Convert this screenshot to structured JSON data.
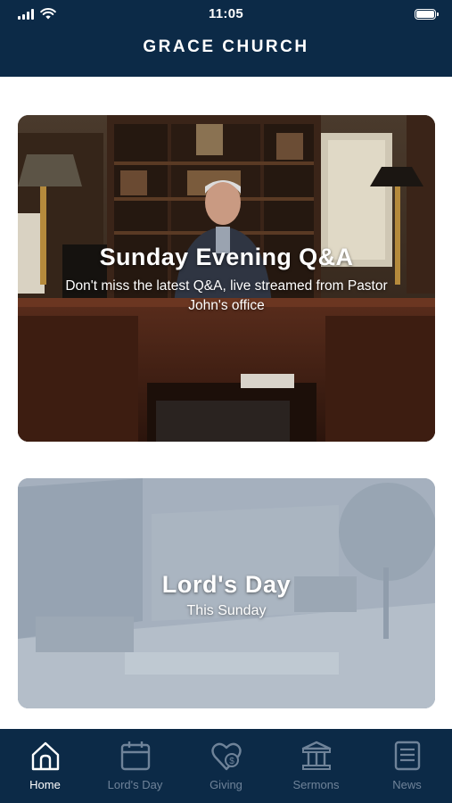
{
  "status_bar": {
    "time": "11:05"
  },
  "header": {
    "title": "GRACE CHURCH"
  },
  "cards": [
    {
      "title": "Sunday Evening Q&A",
      "subtitle": "Don't miss the latest Q&A, live streamed from Pastor John's office"
    },
    {
      "title": "Lord's Day",
      "subtitle": "This Sunday"
    }
  ],
  "tabs": [
    {
      "label": "Home",
      "icon": "home-icon",
      "active": true
    },
    {
      "label": "Lord's Day",
      "icon": "calendar-icon",
      "active": false
    },
    {
      "label": "Giving",
      "icon": "heart-dollar-icon",
      "active": false
    },
    {
      "label": "Sermons",
      "icon": "pillars-icon",
      "active": false
    },
    {
      "label": "News",
      "icon": "news-icon",
      "active": false
    }
  ],
  "colors": {
    "navy": "#0c2a47",
    "inactive_tab": "#6f8399",
    "active_tab": "#ffffff"
  }
}
